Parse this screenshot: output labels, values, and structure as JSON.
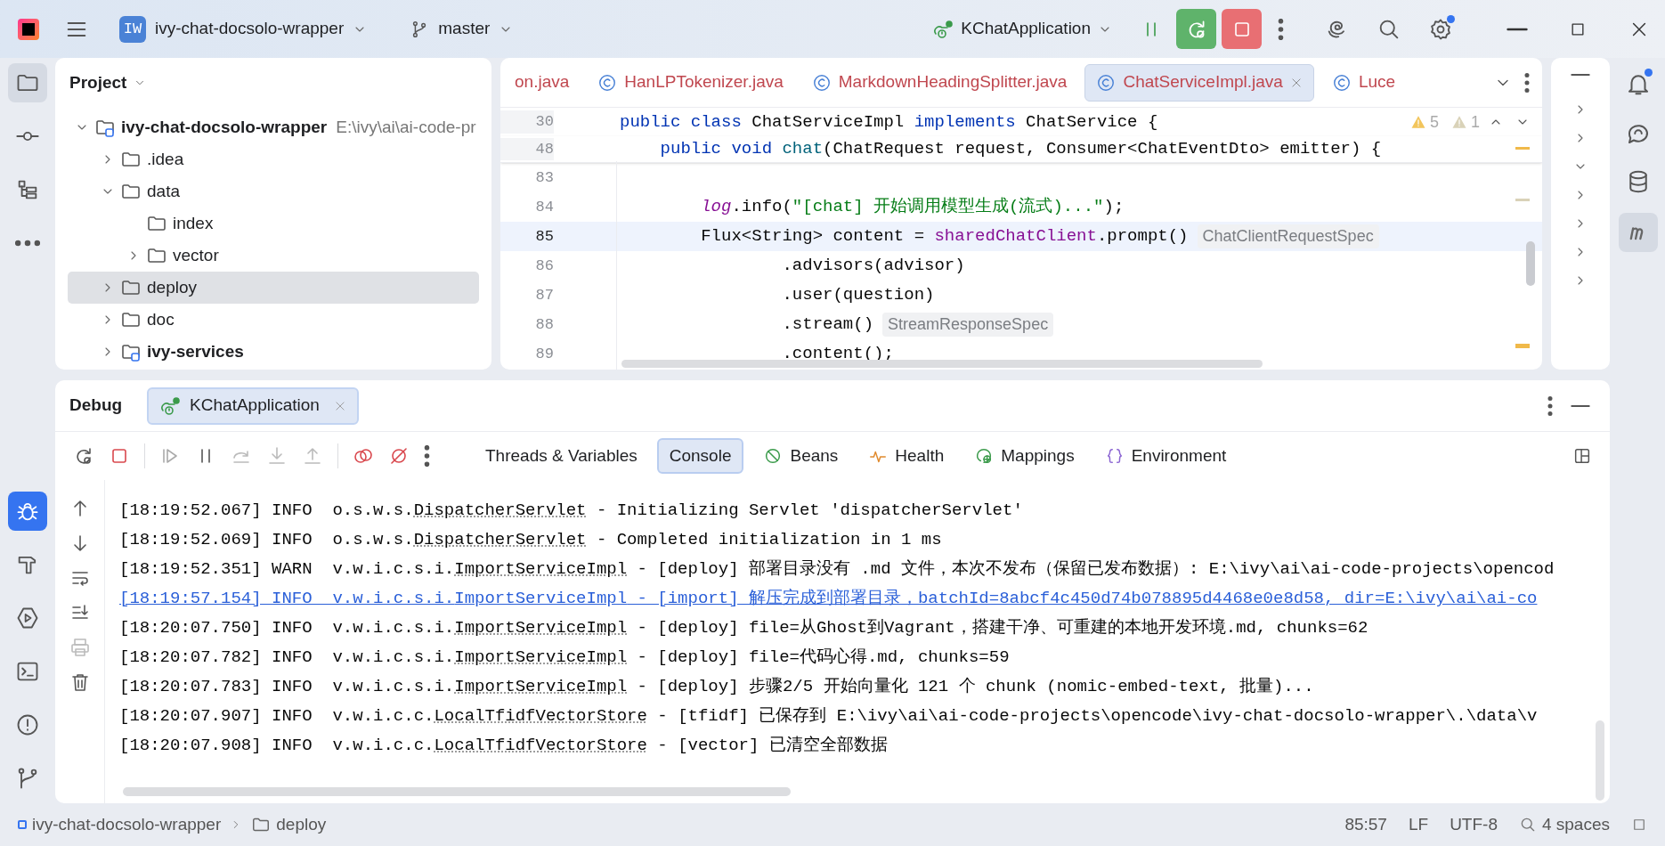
{
  "title_bar": {
    "project_badge": "IW",
    "project": "ivy-chat-docsolo-wrapper",
    "branch": "master",
    "run_config": "KChatApplication"
  },
  "project_panel": {
    "title": "Project",
    "tree": [
      {
        "name": "ivy-chat-docsolo-wrapper",
        "path": "E:\\ivy\\ai\\ai-code-pr",
        "kind": "module",
        "expanded": true,
        "selected": false,
        "children": [
          {
            "name": ".idea",
            "kind": "folder",
            "expanded": false,
            "selected": false
          },
          {
            "name": "data",
            "kind": "folder",
            "expanded": true,
            "selected": false,
            "children": [
              {
                "name": "index",
                "kind": "leaf",
                "expanded": false,
                "selected": false
              },
              {
                "name": "vector",
                "kind": "folder",
                "expanded": false,
                "selected": false
              }
            ]
          },
          {
            "name": "deploy",
            "kind": "folder",
            "expanded": false,
            "selected": true
          },
          {
            "name": "doc",
            "kind": "folder",
            "expanded": false,
            "selected": false
          },
          {
            "name": "ivy-services",
            "kind": "module",
            "expanded": false,
            "selected": false
          }
        ]
      }
    ]
  },
  "editor": {
    "tabs": [
      {
        "label": "on.java",
        "icon": false,
        "selected": false,
        "closable": false
      },
      {
        "label": "HanLPTokenizer.java",
        "icon": true,
        "selected": false,
        "closable": false
      },
      {
        "label": "MarkdownHeadingSplitter.java",
        "icon": true,
        "selected": false,
        "closable": false
      },
      {
        "label": "ChatServiceImpl.java",
        "icon": true,
        "selected": true,
        "closable": true
      },
      {
        "label": "Luce",
        "icon": true,
        "selected": false,
        "closable": false
      }
    ],
    "warnings": "5",
    "weak_warnings": "1",
    "lines": [
      {
        "number": "30",
        "sticky": true,
        "current": false,
        "segments": [
          {
            "kind": "kw",
            "text": "public class "
          },
          {
            "kind": "plain",
            "text": "ChatServiceImpl "
          },
          {
            "kind": "kw",
            "text": "implements "
          },
          {
            "kind": "plain",
            "text": "ChatService {"
          }
        ]
      },
      {
        "number": "48",
        "sticky": true,
        "current": false,
        "segments": [
          {
            "kind": "kw",
            "text": "    public void "
          },
          {
            "kind": "method",
            "text": "chat"
          },
          {
            "kind": "plain",
            "text": "(ChatRequest request, Consumer<ChatEventDto> emitter) {"
          }
        ]
      },
      {
        "number": "83",
        "sticky": false,
        "current": false
      },
      {
        "number": "84",
        "sticky": false,
        "current": false,
        "segments": [
          {
            "kind": "static",
            "text": "        log"
          },
          {
            "kind": "plain",
            "text": ".info("
          },
          {
            "kind": "str",
            "text": "\"[chat] 开始调用模型生成(流式)...\""
          },
          {
            "kind": "plain",
            "text": ");"
          }
        ]
      },
      {
        "number": "85",
        "sticky": false,
        "current": true,
        "segments": [
          {
            "kind": "plain",
            "text": "        Flux<String> content = "
          },
          {
            "kind": "field",
            "text": "sharedChatClient"
          },
          {
            "kind": "plain",
            "text": ".prompt()"
          },
          {
            "kind": "hint",
            "text": "ChatClientRequestSpec"
          }
        ]
      },
      {
        "number": "86",
        "sticky": false,
        "current": false,
        "segments": [
          {
            "kind": "plain",
            "text": "                .advisors(advisor)"
          }
        ]
      },
      {
        "number": "87",
        "sticky": false,
        "current": false,
        "segments": [
          {
            "kind": "plain",
            "text": "                .user(question)"
          }
        ]
      },
      {
        "number": "88",
        "sticky": false,
        "current": false,
        "segments": [
          {
            "kind": "plain",
            "text": "                .stream()"
          },
          {
            "kind": "hint",
            "text": "StreamResponseSpec"
          }
        ]
      },
      {
        "number": "89",
        "sticky": false,
        "current": false,
        "segments": [
          {
            "kind": "plain",
            "text": "                .content();"
          }
        ]
      }
    ]
  },
  "debug": {
    "title": "Debug",
    "session": "KChatApplication",
    "tabs": [
      {
        "label": "Threads & Variables",
        "selected": false
      },
      {
        "label": "Console",
        "selected": true
      },
      {
        "label": "Beans",
        "selected": false
      },
      {
        "label": "Health",
        "selected": false
      },
      {
        "label": "Mappings",
        "selected": false
      },
      {
        "label": "Environment",
        "selected": false
      }
    ],
    "console": [
      {
        "time": "[18:19:52.067]",
        "level": "INFO",
        "package": "o.s.w.s.",
        "logger": "DispatcherServlet",
        "message": " - Initializing Servlet 'dispatcherServlet'",
        "selected": false
      },
      {
        "time": "[18:19:52.069]",
        "level": "INFO",
        "package": "o.s.w.s.",
        "logger": "DispatcherServlet",
        "message": " - Completed initialization in 1 ms",
        "selected": false
      },
      {
        "time": "[18:19:52.351]",
        "level": "WARN",
        "package": "v.w.i.c.s.i.",
        "logger": "ImportServiceImpl",
        "message": " - [deploy] 部署目录没有 .md 文件，本次不发布（保留已发布数据）: E:\\ivy\\ai\\ai-code-projects\\opencod",
        "selected": false
      },
      {
        "time": "[18:19:57.154]",
        "level": "INFO",
        "package": "v.w.i.c.s.i.",
        "logger": "ImportServiceImpl",
        "message": " - [import] 解压完成到部署目录，batchId=8abcf4c450d74b078895d4468e0e8d58, dir=E:\\ivy\\ai\\ai-co",
        "selected": true
      },
      {
        "time": "[18:20:07.750]",
        "level": "INFO",
        "package": "v.w.i.c.s.i.",
        "logger": "ImportServiceImpl",
        "message": " - [deploy] file=从Ghost到Vagrant，搭建干净、可重建的本地开发环境.md, chunks=62",
        "selected": false
      },
      {
        "time": "[18:20:07.782]",
        "level": "INFO",
        "package": "v.w.i.c.s.i.",
        "logger": "ImportServiceImpl",
        "message": " - [deploy] file=代码心得.md, chunks=59",
        "selected": false
      },
      {
        "time": "[18:20:07.783]",
        "level": "INFO",
        "package": "v.w.i.c.s.i.",
        "logger": "ImportServiceImpl",
        "message": " - [deploy] 步骤2/5 开始向量化 121 个 chunk (nomic-embed-text, 批量)...",
        "selected": false
      },
      {
        "time": "[18:20:07.907]",
        "level": "INFO",
        "package": "v.w.i.c.c.",
        "logger": "LocalTfidfVectorStore",
        "message": " - [tfidf] 已保存到 E:\\ivy\\ai\\ai-code-projects\\opencode\\ivy-chat-docsolo-wrapper\\.\\data\\v",
        "selected": false
      },
      {
        "time": "[18:20:07.908]",
        "level": "INFO",
        "package": "v.w.i.c.c.",
        "logger": "LocalTfidfVectorStore",
        "message": " - [vector] 已清空全部数据",
        "selected": false
      }
    ]
  },
  "status_bar": {
    "breadcrumbs": [
      {
        "label": "ivy-chat-docsolo-wrapper",
        "kind": "module"
      },
      {
        "label": "deploy",
        "kind": "folder"
      }
    ],
    "position": "85:57",
    "line_separator": "LF",
    "encoding": "UTF-8",
    "indent": "4 spaces"
  }
}
